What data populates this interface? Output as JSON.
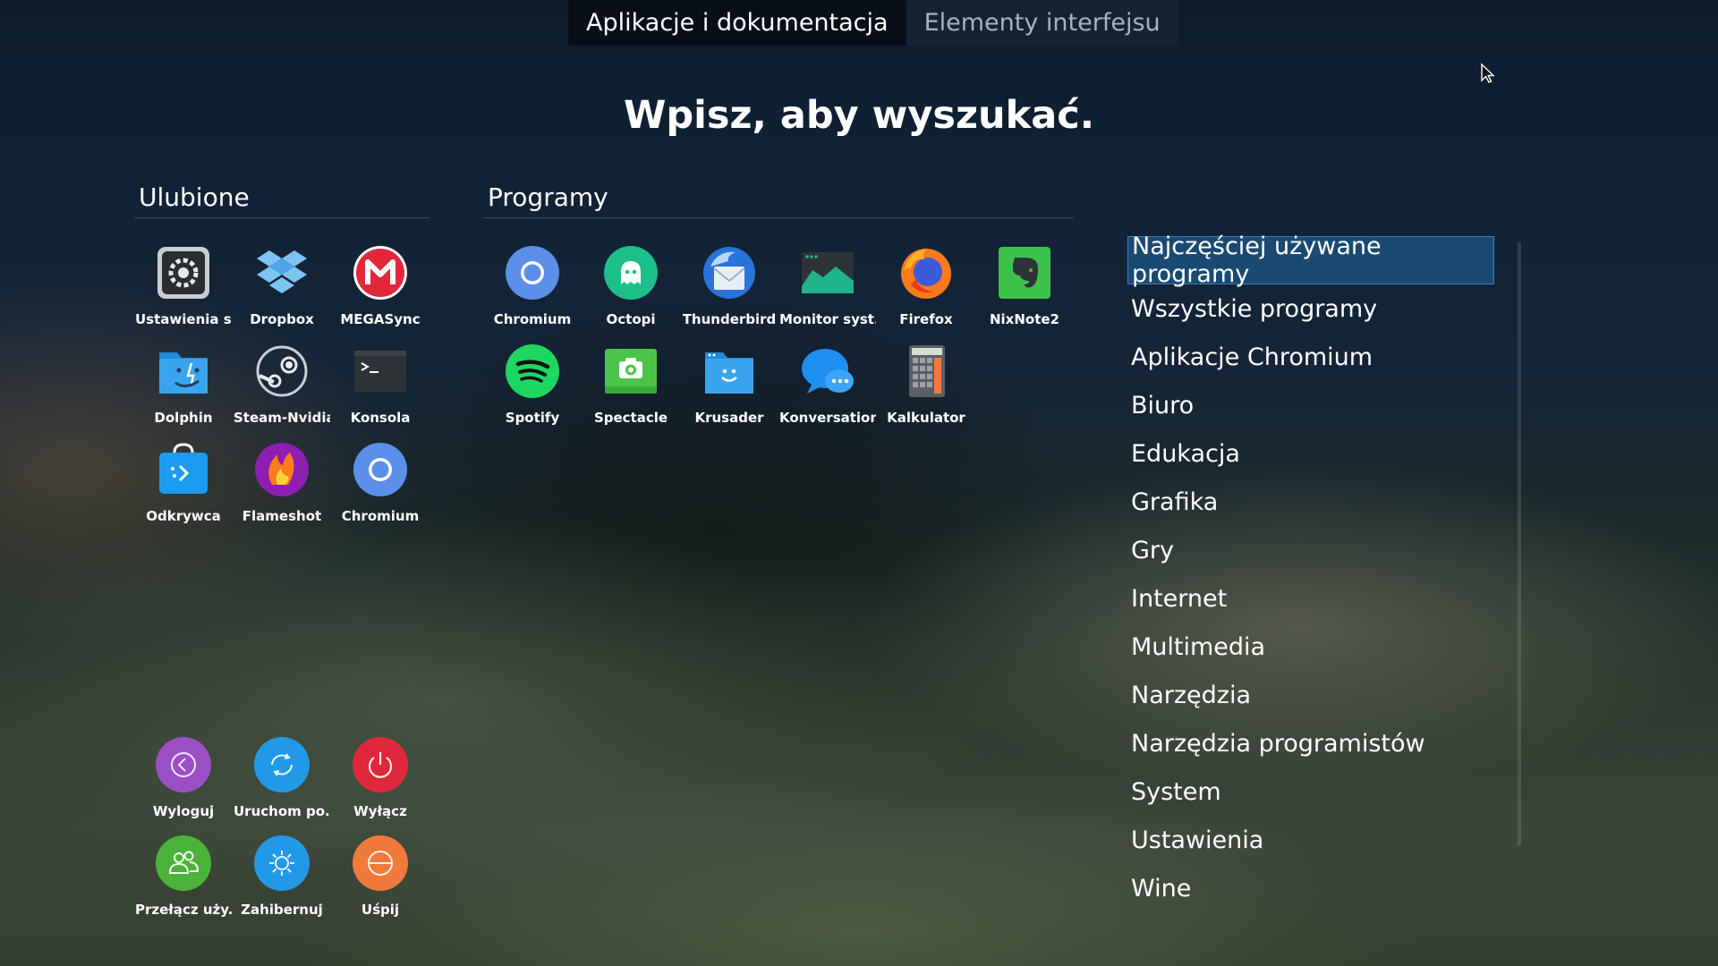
{
  "tabs": [
    {
      "label": "Aplikacje i dokumentacja",
      "active": true
    },
    {
      "label": "Elementy interfejsu",
      "active": false
    }
  ],
  "search_hint": "Wpisz, aby wyszukać.",
  "favorites": {
    "title": "Ulubione",
    "items": [
      {
        "label": "Ustawienia s...",
        "icon": "settings-icon"
      },
      {
        "label": "Dropbox",
        "icon": "dropbox-icon"
      },
      {
        "label": "MEGASync",
        "icon": "megasync-icon"
      },
      {
        "label": "Dolphin",
        "icon": "dolphin-icon"
      },
      {
        "label": "Steam-Nvidia",
        "icon": "steam-icon"
      },
      {
        "label": "Konsola",
        "icon": "terminal-icon"
      },
      {
        "label": "Odkrywca",
        "icon": "discover-icon"
      },
      {
        "label": "Flameshot",
        "icon": "flameshot-icon"
      },
      {
        "label": "Chromium",
        "icon": "chromium-icon"
      }
    ]
  },
  "programs": {
    "title": "Programy",
    "items": [
      {
        "label": "Chromium",
        "icon": "chromium-icon"
      },
      {
        "label": "Octopi",
        "icon": "octopi-icon"
      },
      {
        "label": "Thunderbird",
        "icon": "thunderbird-icon"
      },
      {
        "label": "Monitor syst...",
        "icon": "system-monitor-icon"
      },
      {
        "label": "Firefox",
        "icon": "firefox-icon"
      },
      {
        "label": "NixNote2",
        "icon": "nixnote-icon"
      },
      {
        "label": "Spotify",
        "icon": "spotify-icon"
      },
      {
        "label": "Spectacle",
        "icon": "spectacle-icon"
      },
      {
        "label": "Krusader",
        "icon": "krusader-icon"
      },
      {
        "label": "Konversation",
        "icon": "konversation-icon"
      },
      {
        "label": "Kalkulator",
        "icon": "calculator-icon"
      }
    ]
  },
  "session": {
    "items": [
      {
        "label": "Wyloguj",
        "icon": "logout-icon",
        "color": "#9b4fc4"
      },
      {
        "label": "Uruchom po...",
        "icon": "restart-icon",
        "color": "#2299e6"
      },
      {
        "label": "Wyłącz",
        "icon": "power-icon",
        "color": "#e0283c"
      },
      {
        "label": "Przełącz uży...",
        "icon": "switch-user-icon",
        "color": "#4cb33a"
      },
      {
        "label": "Zahibernuj",
        "icon": "hibernate-icon",
        "color": "#2299e6"
      },
      {
        "label": "Uśpij",
        "icon": "sleep-icon",
        "color": "#f07a3c"
      }
    ]
  },
  "categories": [
    {
      "label": "Najczęściej używane programy",
      "selected": true
    },
    {
      "label": "Wszystkie programy"
    },
    {
      "label": "Aplikacje Chromium"
    },
    {
      "label": "Biuro"
    },
    {
      "label": "Edukacja"
    },
    {
      "label": "Grafika"
    },
    {
      "label": "Gry"
    },
    {
      "label": "Internet"
    },
    {
      "label": "Multimedia"
    },
    {
      "label": "Narzędzia"
    },
    {
      "label": "Narzędzia programistów"
    },
    {
      "label": "System"
    },
    {
      "label": "Ustawienia"
    },
    {
      "label": "Wine"
    }
  ],
  "colors": {
    "accent": "#1a4a72",
    "accent_border": "#3b7fb8"
  }
}
